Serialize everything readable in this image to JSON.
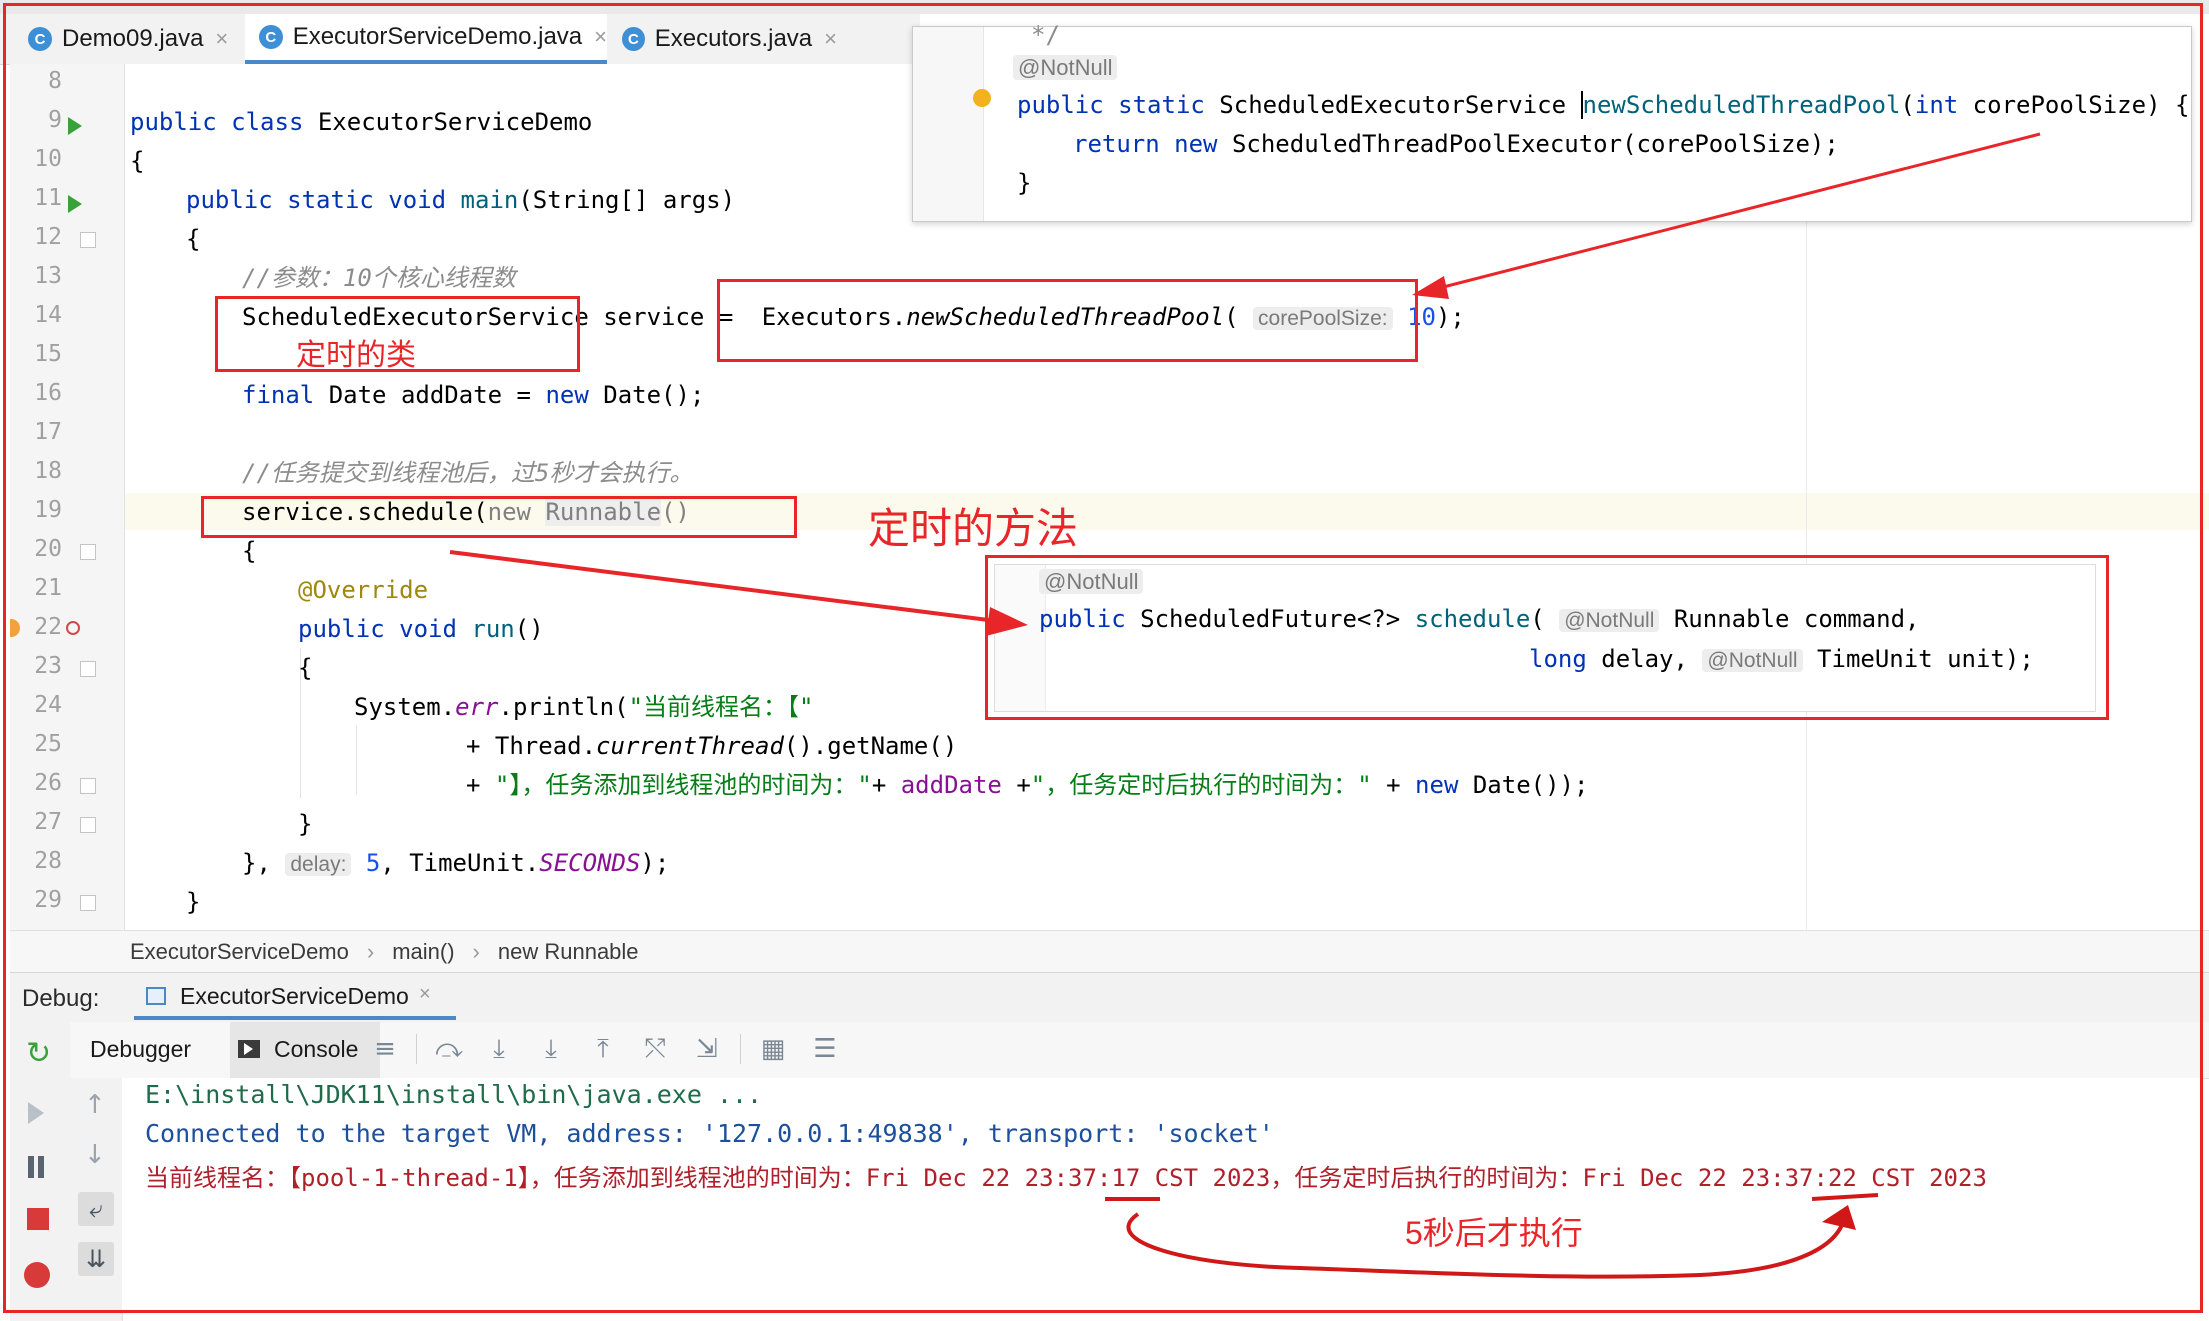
{
  "tabs": [
    {
      "label": "Demo09.java",
      "active": false
    },
    {
      "label": "ExecutorServiceDemo.java",
      "active": true
    },
    {
      "label": "Executors.java",
      "active": false
    }
  ],
  "tab_close": "×",
  "line_numbers": [
    "8",
    "9",
    "10",
    "11",
    "12",
    "13",
    "14",
    "15",
    "16",
    "17",
    "18",
    "19",
    "20",
    "21",
    "22",
    "23",
    "24",
    "25",
    "26",
    "27",
    "28",
    "29"
  ],
  "code": {
    "l9_kw": "public class ",
    "l9_name": "ExecutorServiceDemo",
    "l10": "{",
    "l11_kw": "public static void ",
    "l11_fn": "main",
    "l11_rest": "(String[] args)",
    "l12": "{",
    "l13_comment": "//参数：10个核心线程数",
    "l14_type": "ScheduledExecutorService",
    "l14_var": " service = ",
    "l14_call": "Executors.",
    "l14_method": "newScheduledThreadPool",
    "l14_open": "(",
    "l14_hint": "corePoolSize:",
    "l14_num": "10",
    "l14_close": ");",
    "l16_kw": "final ",
    "l16_mid": "Date addDate = ",
    "l16_new": "new ",
    "l16_end": "Date();",
    "l18_comment": "//任务提交到线程池后，过5秒才会执行。",
    "l19_call": "service.schedule(",
    "l19_new": "new ",
    "l19_type": "Runnable",
    "l19_paren": "()",
    "l20": "{",
    "l21_anno": "@Override",
    "l22_kw": "public void ",
    "l22_fn": "run",
    "l22_paren": "()",
    "l23": "{",
    "l24_a": "System.",
    "l24_err": "err",
    "l24_b": ".println(",
    "l24_str": "\"当前线程名：【\"",
    "l25_a": "+ Thread.",
    "l25_it": "currentThread",
    "l25_b": "().getName()",
    "l26_a": "+ ",
    "l26_str1": "\"】，任务添加到线程池的时间为：\"",
    "l26_b": "+ ",
    "l26_var": "addDate",
    "l26_c": " +",
    "l26_str2": "\"，任务定时后执行的时间为：\"",
    "l26_d": " + ",
    "l26_new": "new ",
    "l26_e": "Date());",
    "l27": "}",
    "l28_a": "}, ",
    "l28_hint": "delay:",
    "l28_num": "5",
    "l28_b": ", TimeUnit.",
    "l28_const": "SECONDS",
    "l28_c": ");",
    "l29": "}"
  },
  "popup_top": {
    "comment_end": "*/",
    "annotation": "@NotNull",
    "l1_kw": "public static ",
    "l1_type": "ScheduledExecutorService ",
    "l1_fn": "newScheduledThreadPool",
    "l1_args_open": "(",
    "l1_int": "int ",
    "l1_rest": "corePoolSize) {",
    "l2_kw": "return new ",
    "l2_rest": "ScheduledThreadPoolExecutor(corePoolSize);",
    "l3": "}"
  },
  "popup_bottom": {
    "annotation": "@NotNull",
    "l1_kw": "public ",
    "l1_type": "ScheduledFuture<?> ",
    "l1_fn": "schedule",
    "l1_open": "( ",
    "l1_anno": "@NotNull",
    "l1_rest": " Runnable command,",
    "l2_kw": "long ",
    "l2_mid": "delay, ",
    "l2_anno": "@NotNull",
    "l2_rest": " TimeUnit unit);"
  },
  "annotations": {
    "class_label": "定时的类",
    "method_label": "定时的方法",
    "delay_label": "5秒后才执行"
  },
  "breadcrumb": [
    "ExecutorServiceDemo",
    "main()",
    "new Runnable"
  ],
  "breadcrumb_sep": "›",
  "debug": {
    "label": "Debug:",
    "config": "ExecutorServiceDemo",
    "tab_debugger": "Debugger",
    "tab_console": "Console"
  },
  "console": {
    "line1": "E:\\install\\JDK11\\install\\bin\\java.exe ...",
    "line2": "Connected to the target VM, address: '127.0.0.1:49838', transport: 'socket'",
    "line3": "当前线程名：【pool-1-thread-1】，任务添加到线程池的时间为：Fri Dec 22 23:37:17 CST 2023，任务定时后执行的时间为：Fri Dec 22 23:37:22 CST 2023"
  },
  "colors": {
    "keyword": "#0033b3",
    "string": "#067d17",
    "annotation_red": "#e8262a",
    "console_green": "#1f6b4a",
    "console_blue": "#1c4f9c",
    "console_red": "#b0202a"
  }
}
